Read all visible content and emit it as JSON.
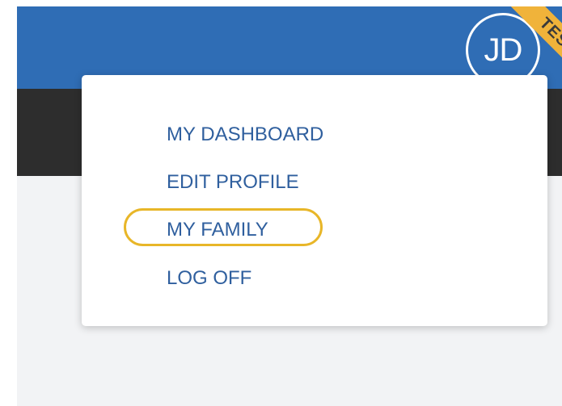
{
  "header": {
    "user_initials": "JD",
    "environment_badge": "TEST"
  },
  "user_menu": {
    "items": [
      {
        "label": "MY DASHBOARD"
      },
      {
        "label": "EDIT PROFILE"
      },
      {
        "label": "MY FAMILY",
        "highlighted": true
      },
      {
        "label": "LOG OFF"
      }
    ]
  },
  "colors": {
    "header_blue": "#2f6db5",
    "nav_dark": "#2d2d2d",
    "menu_link": "#2f5f9e",
    "highlight": "#e8b628",
    "badge": "#f0b33a"
  }
}
